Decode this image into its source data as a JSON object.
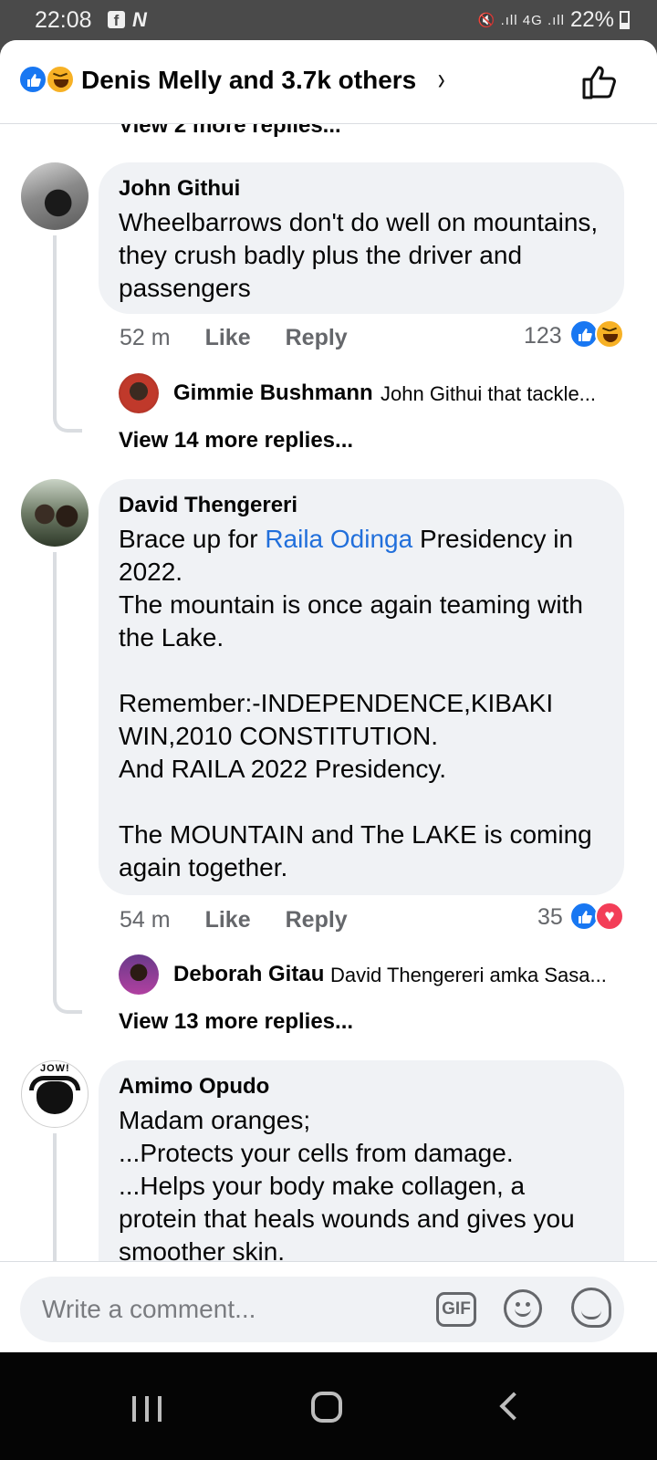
{
  "status_bar": {
    "time": "22:08",
    "app_icon_f": "f",
    "app_icon_n": "N",
    "signal_icons": "🔇 .ıll 4G .ıll",
    "battery": "22%"
  },
  "header": {
    "title": "Denis Melly and 3.7k others",
    "chevron": "›"
  },
  "partial_reply_text": "View 2 more replies...",
  "comments": [
    {
      "name": "John Githui",
      "text": "Wheelbarrows don't do well on mountains, they crush badly plus the driver and passengers",
      "time": "52 m",
      "like_label": "Like",
      "reply_label": "Reply",
      "reaction_count": "123",
      "reactions": [
        "like-icon",
        "haha-icon"
      ],
      "top_reply": {
        "name": "Gimmie Bushmann",
        "text": "John Githui that tackle..."
      },
      "view_more": "View 14 more replies..."
    },
    {
      "name": "David Thengereri",
      "text_before_link": "Brace up for ",
      "link_text": "Raila Odinga",
      "text_after_link": " Presidency in 2022.\nThe mountain is once again teaming with the Lake.\n\nRemember:-INDEPENDENCE,KIBAKI WIN,2010 CONSTITUTION.\nAnd RAILA 2022 Presidency.\n\nThe MOUNTAIN and The LAKE is coming again together.",
      "time": "54 m",
      "like_label": "Like",
      "reply_label": "Reply",
      "reaction_count": "35",
      "reactions": [
        "like-icon",
        "love-icon"
      ],
      "top_reply": {
        "name": "Deborah Gitau",
        "text": "David Thengereri  amka Sasa..."
      },
      "view_more": "View 13 more replies..."
    },
    {
      "name": "Amimo Opudo",
      "avatar_text": "JOW!",
      "text": "Madam oranges;\n...Protects your cells from damage.\n...Helps your body make collagen, a protein that heals wounds and gives you smoother skin."
    }
  ],
  "composer": {
    "placeholder": "Write a comment...",
    "gif_label": "GIF"
  },
  "colors": {
    "link": "#216fdb",
    "like_blue": "#1877f2",
    "haha_yellow": "#f7b125",
    "love_red": "#f33e58",
    "bubble_bg": "#f0f2f5",
    "meta_gray": "#65676b"
  }
}
